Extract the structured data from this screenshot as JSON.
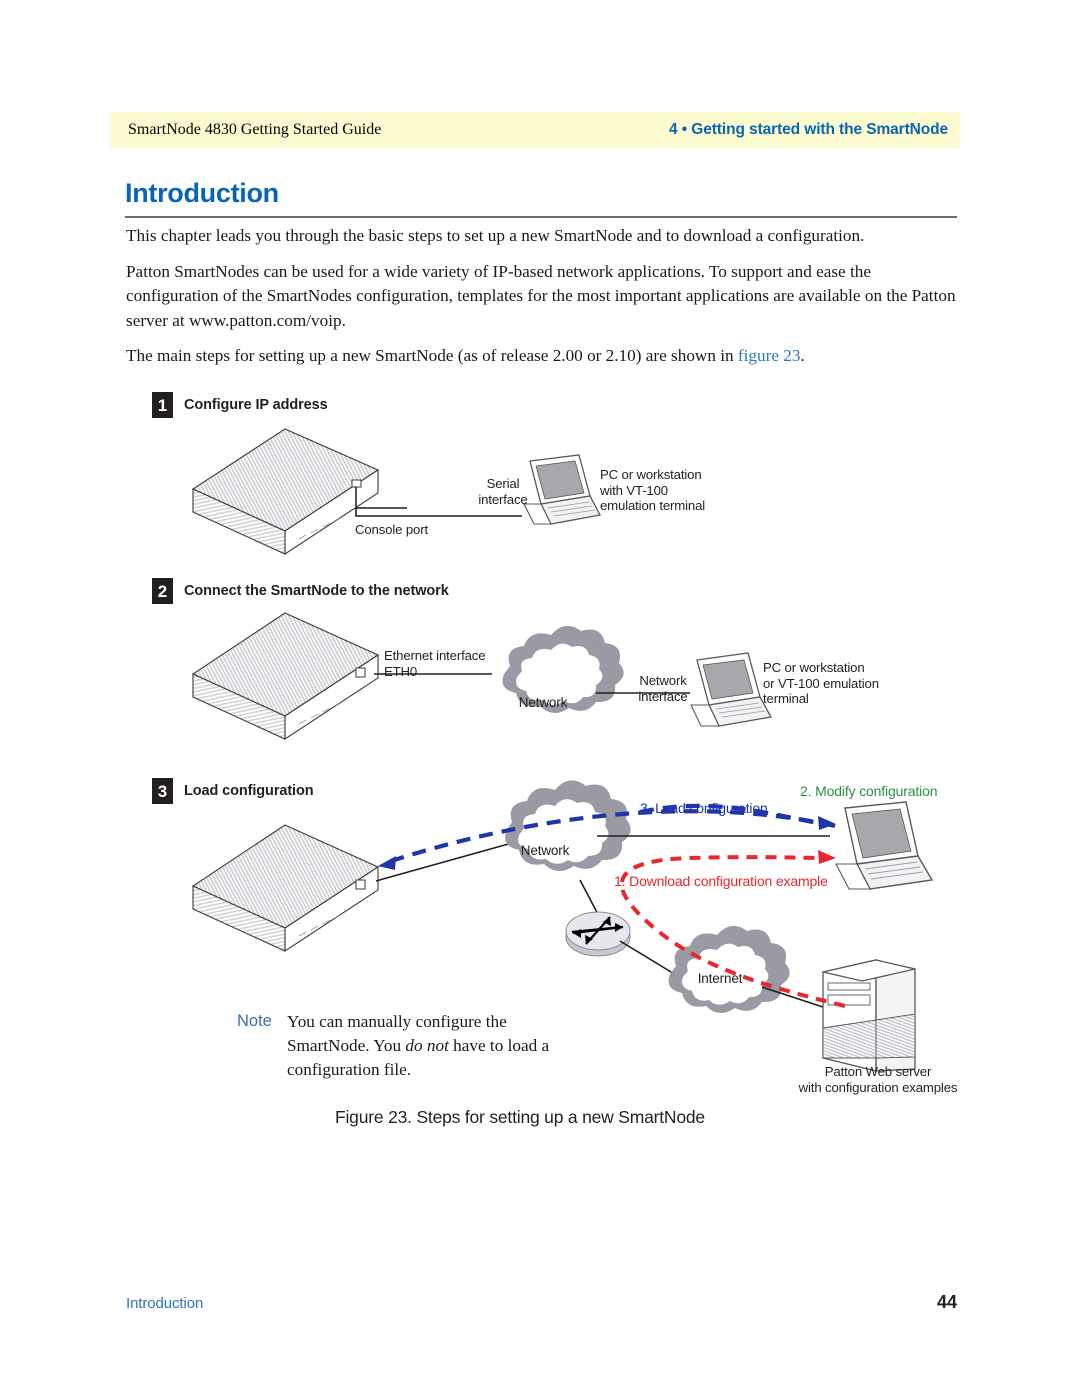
{
  "header": {
    "left": "SmartNode 4830 Getting Started Guide",
    "right": "4 • Getting started with the SmartNode"
  },
  "section": {
    "title": "Introduction"
  },
  "body": {
    "paragraph_1": "This chapter leads you through the basic steps to set up a new SmartNode and to download a configuration.",
    "paragraph_2": "Patton SmartNodes can be used for a wide variety of IP-based network applications. To support and ease the configuration of the SmartNodes configuration, templates for the most important applications are available on the Patton server at www.patton.com/voip.",
    "paragraph_3_pre": "The main steps for setting up a new SmartNode (as of release 2.00 or 2.10) are shown in ",
    "paragraph_3_link": "figure 23",
    "paragraph_3_post": "."
  },
  "figure": {
    "caption": "Figure 23. Steps for setting up a new SmartNode",
    "steps": [
      {
        "number": "1",
        "title": "Configure IP address",
        "labels": {
          "console_port": "Console port",
          "serial_interface": "Serial\ninterface",
          "workstation": "PC or workstation\nwith VT-100\nemulation terminal"
        }
      },
      {
        "number": "2",
        "title": "Connect the SmartNode to the network",
        "labels": {
          "ethernet_interface": "Ethernet interface\nETH0",
          "cloud_network": "Network",
          "network_interface": "Network\ninterface",
          "workstation": "PC or workstation\nor VT-100 emulation\nterminal"
        }
      },
      {
        "number": "3",
        "title": "Load configuration",
        "labels": {
          "cloud_network": "Network",
          "cloud_internet": "Internet",
          "flow_1": "1. Download configuration example",
          "flow_2": "2. Modify configuration",
          "flow_3": "3. Load configuration",
          "web_server": "Patton Web server\nwith configuration examples"
        }
      }
    ]
  },
  "note": {
    "label": "Note",
    "text_1": "You can manually configure the SmartNode. You ",
    "text_emphasis": "do not",
    "text_2": " have to load a configuration file."
  },
  "footer": {
    "left": "Introduction",
    "page_number": "44"
  },
  "colors": {
    "header_band": "#fdfbd0",
    "brand_blue": "#0a64b4",
    "link_blue": "#2f76bb",
    "flow_blue": "#2036a8",
    "flow_green": "#2f8f46",
    "flow_red": "#e8272c",
    "cloud_gray": "#9a9aa5",
    "badge_black": "#231f20"
  }
}
